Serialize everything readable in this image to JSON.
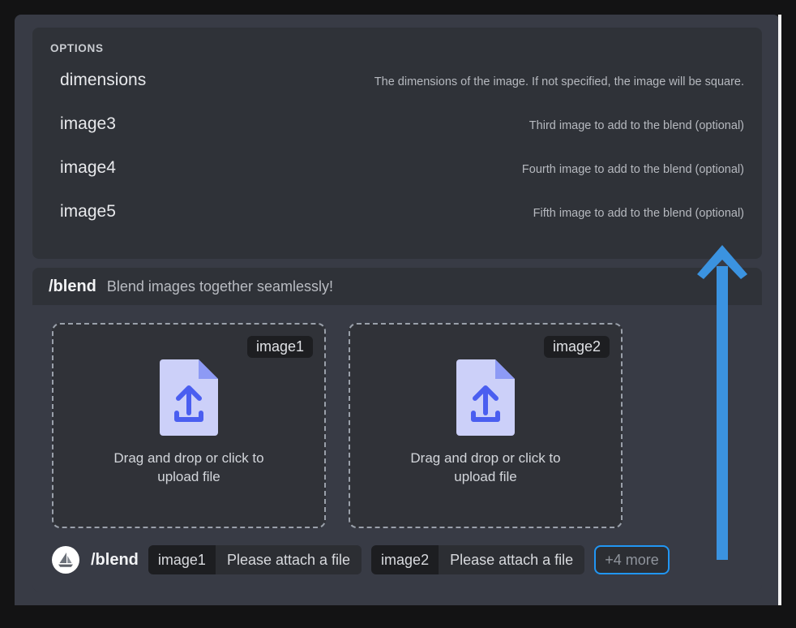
{
  "options_panel": {
    "heading": "OPTIONS",
    "rows": [
      {
        "name": "dimensions",
        "desc": "The dimensions of the image. If not specified, the image will be square."
      },
      {
        "name": "image3",
        "desc": "Third image to add to the blend (optional)"
      },
      {
        "name": "image4",
        "desc": "Fourth image to add to the blend (optional)"
      },
      {
        "name": "image5",
        "desc": "Fifth image to add to the blend (optional)"
      }
    ]
  },
  "command_card": {
    "header": {
      "command": "/blend",
      "tagline": "Blend images together seamlessly!"
    },
    "dropzones": [
      {
        "pill": "image1",
        "label": "Drag and drop or click to upload file",
        "icon": "file-upload-icon"
      },
      {
        "pill": "image2",
        "label": "Drag and drop or click to upload file",
        "icon": "file-upload-icon"
      }
    ]
  },
  "command_bar": {
    "avatar_icon": "sailboat-avatar-icon",
    "command": "/blend",
    "args": [
      {
        "key": "image1",
        "value": "Please attach a file"
      },
      {
        "key": "image2",
        "value": "Please attach a file"
      }
    ],
    "more_chip": "+4 more"
  },
  "annotation": {
    "arrow_icon": "up-arrow-annotation-icon",
    "color": "#3b93e0"
  },
  "colors": {
    "page_background": "#131314",
    "frame_background": "#383b45",
    "panel_background": "#2f3238",
    "pill_background": "#1d1e21",
    "accent_blue": "#2196f3",
    "file_icon_page": "#ccd0f9",
    "file_icon_fold": "#8d9af5",
    "file_icon_arrow": "#4a5ef0",
    "scrollbar": "#f3f3f3"
  }
}
